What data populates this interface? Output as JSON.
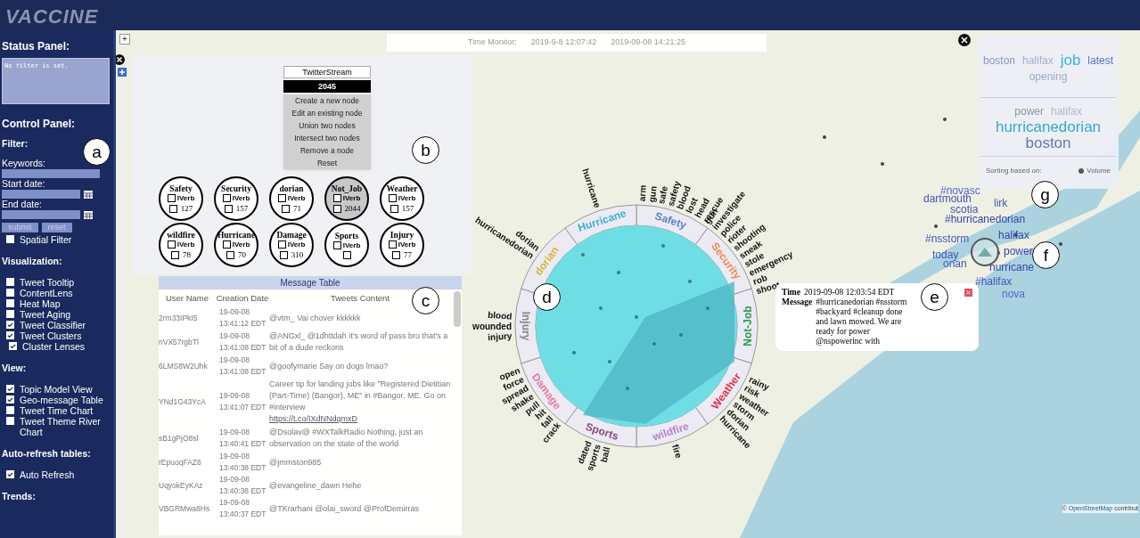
{
  "header": {
    "logo": "VACCINE"
  },
  "sidebar": {
    "status": {
      "title": "Status Panel:",
      "text": "No filter is set."
    },
    "control_title": "Control Panel:",
    "filter": {
      "title": "Filter:",
      "fields": [
        {
          "label": "Keywords:",
          "calendar": false
        },
        {
          "label": "Start date:",
          "calendar": true
        },
        {
          "label": "End date:",
          "calendar": true
        }
      ],
      "buttons": [
        "submit",
        "reset"
      ],
      "spatial": {
        "label": "Spatial Filter",
        "checked": false
      }
    },
    "sections": [
      {
        "title": "Visualization:",
        "items": [
          {
            "label": "Tweet Tooltip",
            "checked": false
          },
          {
            "label": "ContentLens",
            "checked": false
          },
          {
            "label": "Heat Map",
            "checked": false
          },
          {
            "label": "Tweet Aging",
            "checked": false
          },
          {
            "label": "Tweet Classifier",
            "checked": true
          },
          {
            "label": "Tweet Clusters",
            "checked": true,
            "children": [
              {
                "label": "Cluster Lenses",
                "checked": true
              }
            ]
          }
        ]
      },
      {
        "title": "View:",
        "items": [
          {
            "label": "Topic Model View",
            "checked": true
          },
          {
            "label": "Geo-message Table",
            "checked": true
          },
          {
            "label": "Tweet Time Chart",
            "checked": false
          },
          {
            "label": "Tweet Theme River Chart",
            "checked": false
          }
        ]
      },
      {
        "title": "Auto-refresh tables:",
        "items": [
          {
            "label": "Auto Refresh",
            "checked": true
          }
        ]
      },
      {
        "title": "Trends:"
      }
    ]
  },
  "map_controls": {
    "zoom": "+"
  },
  "time_monitor": {
    "label": "Time Monitor:",
    "start": "2019-9-8 12:07:42",
    "end": "2019-09-08 14:21:25"
  },
  "node_panel": {
    "source": "TwitterStream",
    "count": "2045",
    "menu": [
      "Create a new node",
      "Edit an existing node",
      "Union two nodes",
      "Intersect two nodes",
      "Remove a node",
      "Reset"
    ],
    "nodes": [
      {
        "name": "Safety",
        "verb": "IVerb",
        "verb_checked": false,
        "checked": false,
        "count": "127",
        "selected": false
      },
      {
        "name": "Security",
        "verb": "IVerb",
        "verb_checked": false,
        "checked": false,
        "count": "157",
        "selected": false
      },
      {
        "name": "dorian",
        "verb": "IVerb",
        "verb_checked": false,
        "checked": false,
        "count": "71",
        "selected": false
      },
      {
        "name": "Not_Job",
        "verb": "IVerb",
        "verb_checked": false,
        "checked": false,
        "count": "2044",
        "selected": true
      },
      {
        "name": "Weather",
        "verb": "IVerb",
        "verb_checked": false,
        "checked": false,
        "count": "157",
        "selected": false
      },
      {
        "name": "wildfire",
        "verb": "IVerb",
        "verb_checked": false,
        "checked": false,
        "count": "78",
        "selected": false
      },
      {
        "name": "Hurricane",
        "verb": "IVerb",
        "verb_checked": false,
        "checked": false,
        "count": "70",
        "selected": false
      },
      {
        "name": "Damage",
        "verb": "IVerb",
        "verb_checked": false,
        "checked": false,
        "count": "310",
        "selected": false
      },
      {
        "name": "Sports",
        "verb": "IVerb",
        "verb_checked": false,
        "checked": false,
        "selected": false
      },
      {
        "name": "Injury",
        "verb": "IVerb",
        "verb_checked": false,
        "checked": false,
        "count": "77",
        "selected": false
      }
    ]
  },
  "message_table": {
    "title": "Message Table",
    "columns": [
      "User Name",
      "Creation Date",
      "Tweets Content"
    ],
    "rows": [
      {
        "user": "2rm33IPkI5",
        "date": "19-09-08",
        "time": "13:41:12 EDT",
        "content": "@vtm_ Vai chover kkkkkk"
      },
      {
        "user": "nVX57rgbTl",
        "date": "19-09-08",
        "time": "13:41:08 EDT",
        "content": "@ANGxl_ @1dhttdah it's word of pass bro that's a bit of a dude reckons"
      },
      {
        "user": "6LMS8W2Uhk",
        "date": "19-09-08",
        "time": "13:41:08 EDT",
        "content": "@goofymarie Say on dogs lmao?"
      },
      {
        "user": "YNd1G43YcA",
        "date": "19-09-08",
        "time": "13:41:07 EDT",
        "content": "Career tip for landing jobs like \"Registered Dietitian (Part-Time) (Bangor), ME\" in #Bangor, ME. Go on #interview",
        "link": "https://t.co/IXdNNdqmxD"
      },
      {
        "user": "sB1gPjO8sl",
        "date": "19-09-08",
        "time": "13:40:41 EDT",
        "content": "@Dsolav@ #WXTalkRadio Nothing, just an observation on the state of the world"
      },
      {
        "user": "rEpuoqFAZ6",
        "date": "19-09-08",
        "time": "13:40:38 EDT",
        "content": "@jmmston985"
      },
      {
        "user": "UqyokEyKAz",
        "date": "19-09-08",
        "time": "13:40:38 EDT",
        "content": "@evangeline_dawn Hehe"
      },
      {
        "user": "VBGRMwa8Hs",
        "date": "19-09-08",
        "time": "13:40:37 EDT",
        "content": "@TKrarhani @olai_sword @ProfDemirras"
      }
    ]
  },
  "lens": {
    "segments": [
      {
        "label": "Safety",
        "color": "#5b7fc4",
        "keywords": [
          "arm",
          "gun",
          "safe",
          "safety",
          "blood",
          "lost",
          "head",
          "rescue"
        ]
      },
      {
        "label": "Security",
        "color": "#f08a4b",
        "keywords": [
          "gun",
          "investigate",
          "police",
          "rioter",
          "shooting",
          "sneak",
          "stole",
          "emergency",
          "rob",
          "shoot"
        ]
      },
      {
        "label": "Not-Job",
        "color": "#2e9e4b"
      },
      {
        "label": "Weather",
        "color": "#e0304a",
        "keywords": [
          "rainy",
          "risk",
          "weather",
          "storm",
          "dorian",
          "hurricane"
        ]
      },
      {
        "label": "wildfire",
        "color": "#b77fd0",
        "keywords": [
          "fire"
        ]
      },
      {
        "label": "Sports",
        "color": "#8a4a7a",
        "keywords": [
          "dated",
          "sports",
          "ball"
        ]
      },
      {
        "label": "Damage",
        "color": "#e879a0",
        "keywords": [
          "open",
          "force",
          "spread",
          "shake",
          "pull",
          "hit",
          "fall",
          "crack"
        ]
      },
      {
        "label": "Injury",
        "color": "#888888",
        "keywords": [
          "blood",
          "wounded",
          "injury"
        ]
      },
      {
        "label": "dorian",
        "color": "#d4b830",
        "keywords": [
          "dorian",
          "hurricanedorian"
        ]
      },
      {
        "label": "Hurricane",
        "color": "#3bb0d0",
        "keywords": [
          "hurricane"
        ]
      }
    ]
  },
  "popup": {
    "time_label": "Time",
    "time": "2019-09-08 12:03:54 EDT",
    "message_label": "Message",
    "message": "#hurricanedorian #nsstorm #backyard #cleanup done and lawn mowed. We are ready for power @nspowerinc with"
  },
  "word_cloud": {
    "groups": [
      {
        "words": [
          {
            "text": "boston",
            "color": "#8899bb",
            "kind": "medium"
          },
          {
            "text": "halifax",
            "color": "#a3b0ca",
            "kind": "medium"
          },
          {
            "text": "job",
            "color": "#3bb0e0",
            "kind": "large"
          },
          {
            "text": "latest",
            "color": "#5577bb",
            "kind": "medium"
          },
          {
            "text": "opening",
            "color": "#99aacc",
            "kind": "medium"
          }
        ]
      },
      {
        "words": [
          {
            "text": "power",
            "color": "#8899aa",
            "kind": "medium"
          },
          {
            "text": "halifax",
            "color": "#aabbcc",
            "kind": "medium"
          },
          {
            "text": "hurricanedorian",
            "color": "#33aacc",
            "kind": "large"
          },
          {
            "text": "boston",
            "color": "#6677aa",
            "kind": "large"
          }
        ]
      }
    ],
    "sort_label": "Sorting based on:",
    "sort_option": {
      "label": "Volume",
      "selected": true
    }
  },
  "cluster": {
    "words": [
      {
        "text": "#novasc",
        "color": "#5566cc"
      },
      {
        "text": "dartmouth",
        "color": "#4455bb"
      },
      {
        "text": "scotia",
        "color": "#4455bb"
      },
      {
        "text": "lirk",
        "color": "#4455bb"
      },
      {
        "text": "#hurricanedorian",
        "color": "#3344aa"
      },
      {
        "text": "halifax",
        "color": "#3344aa"
      },
      {
        "text": "#nsstorm",
        "color": "#4455bb"
      },
      {
        "text": "power",
        "color": "#3344aa"
      },
      {
        "text": "today",
        "color": "#4455bb"
      },
      {
        "text": "onan",
        "color": "#4455bb"
      },
      {
        "text": "hurricane",
        "color": "#3344aa"
      },
      {
        "text": "#halifax",
        "color": "#4455bb"
      },
      {
        "text": "nova",
        "color": "#5566cc"
      }
    ]
  },
  "attribution": {
    "symbol": "©",
    "link": "OpenStreetMap",
    "text": "contribut"
  },
  "callouts": [
    "a",
    "b",
    "c",
    "d",
    "e",
    "f",
    "g"
  ]
}
